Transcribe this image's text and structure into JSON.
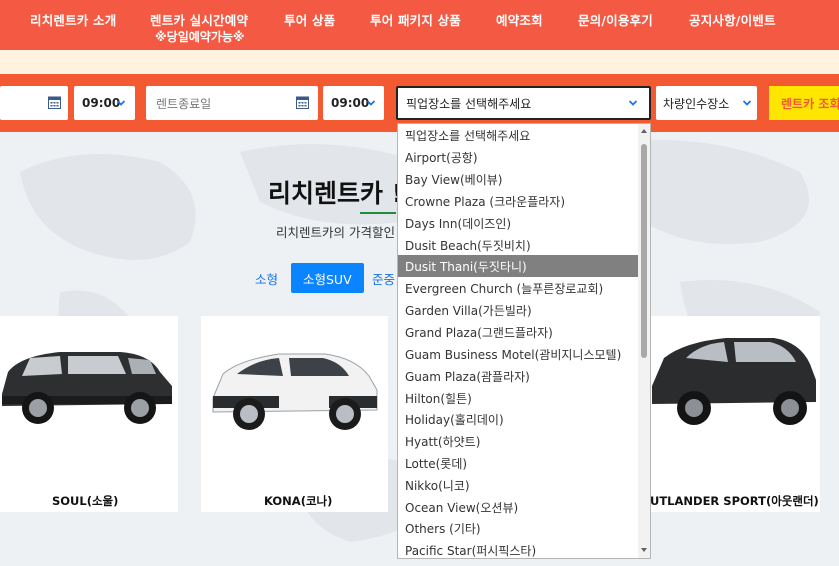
{
  "nav": {
    "items": [
      "리치렌트카 소개",
      "렌트카 실시간예약",
      "투어 상품",
      "투어 패키지 상품",
      "예약조회",
      "문의/이용후기",
      "공지사항/이벤트"
    ],
    "sub_note": "※당일예약가능※"
  },
  "search": {
    "start_time": "09:00",
    "end_date_placeholder": "렌트종료일",
    "end_time": "09:00",
    "pickup_selected": "픽업장소를 선택해주세요",
    "return_label": "차량인수장소",
    "rent_button": "렌트카 조회"
  },
  "main": {
    "title": "리치렌트카 !",
    "subtitle": "리치렌트카의 가격할인",
    "tabs": [
      "소형",
      "소형SUV",
      "준중"
    ],
    "active_tab": "소형SUV",
    "cars": [
      "SOUL(소울)",
      "KONA(코나)",
      "UTLANDER SPORT(아웃랜더)"
    ]
  },
  "pickup_dropdown": {
    "options": [
      "픽업장소를 선택해주세요",
      "Airport(공항)",
      "Bay View(베이뷰)",
      "Crowne Plaza (크라운플라자)",
      "Days Inn(데이즈인)",
      "Dusit Beach(두짓비치)",
      "Dusit Thani(두짓타니)",
      "Evergreen Church (늘푸른장로교회)",
      "Garden Villa(가든빌라)",
      "Grand Plaza(그랜드플라자)",
      "Guam Business Motel(괌비지니스모텔)",
      "Guam Plaza(괌플라자)",
      "Hilton(힐튼)",
      "Holiday(홀리데이)",
      "Hyatt(하얏트)",
      "Lotte(롯데)",
      "Nikko(니코)",
      "Ocean View(오션뷰)",
      "Others (기타)",
      "Pacific Star(퍼시픽스타)"
    ],
    "highlighted": "Dusit Thani(두짓타니)"
  },
  "colors": {
    "nav_bg": "#f45a43",
    "search_bg": "#f45a32",
    "accent_yellow": "#ffe600",
    "tab_active": "#0a84ff",
    "highlight": "#808080"
  },
  "icons": [
    "calendar-icon",
    "chevron-down-icon",
    "scroll-up-icon",
    "scroll-down-icon"
  ]
}
